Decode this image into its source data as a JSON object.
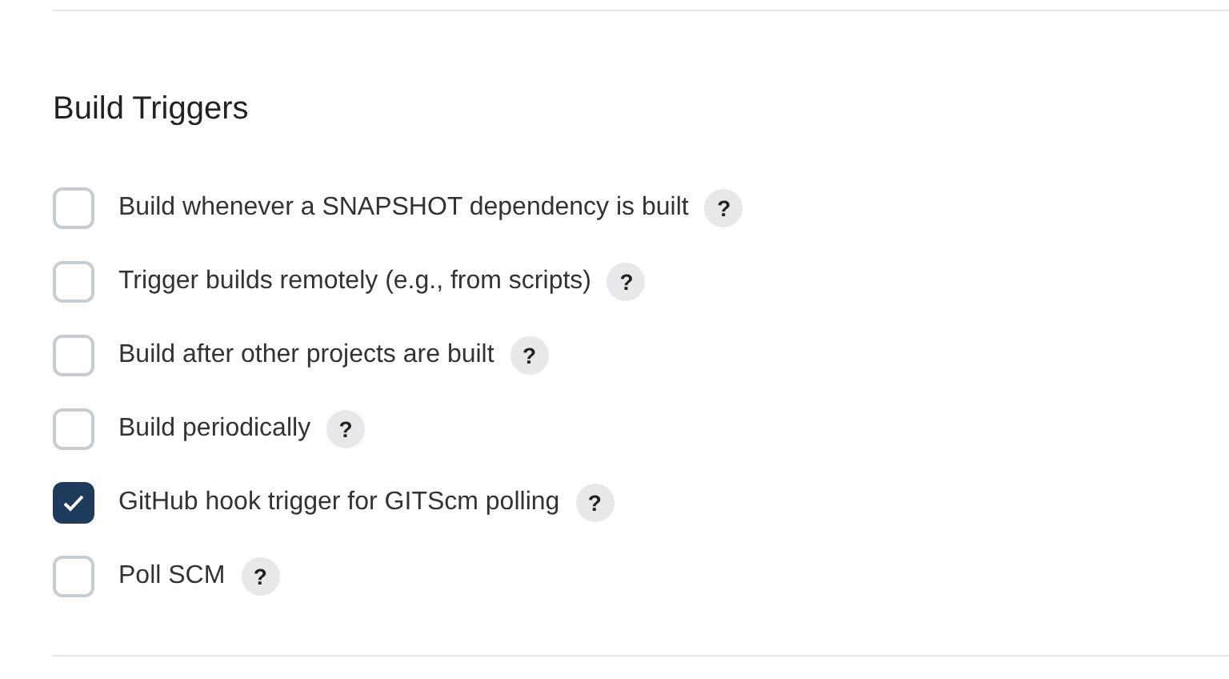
{
  "section": {
    "title": "Build Triggers"
  },
  "triggers": [
    {
      "label": "Build whenever a SNAPSHOT dependency is built",
      "checked": false,
      "help": "?"
    },
    {
      "label": "Trigger builds remotely (e.g., from scripts)",
      "checked": false,
      "help": "?"
    },
    {
      "label": "Build after other projects are built",
      "checked": false,
      "help": "?"
    },
    {
      "label": "Build periodically",
      "checked": false,
      "help": "?"
    },
    {
      "label": "GitHub hook trigger for GITScm polling",
      "checked": true,
      "help": "?"
    },
    {
      "label": "Poll SCM",
      "checked": false,
      "help": "?"
    }
  ]
}
